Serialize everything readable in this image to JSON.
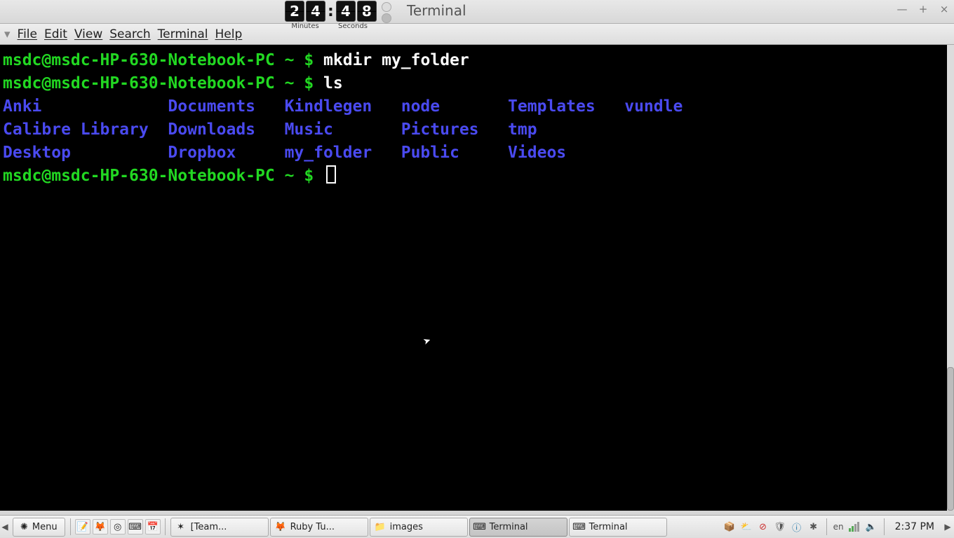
{
  "window": {
    "title": "Terminal",
    "timer": {
      "minutes": "24",
      "seconds": "48",
      "label_min": "Minutes",
      "label_sec": "Seconds"
    }
  },
  "menu": {
    "chevron": "▾",
    "items": [
      "File",
      "Edit",
      "View",
      "Search",
      "Terminal",
      "Help"
    ]
  },
  "prompt": {
    "userhost": "msdc@msdc-HP-630-Notebook-PC",
    "path": "~",
    "symbol": "$"
  },
  "session": {
    "cmd1": "mkdir my_folder",
    "cmd2": "ls",
    "ls": {
      "col1": [
        "Anki",
        "Calibre Library",
        "Desktop"
      ],
      "col2": [
        "Documents",
        "Downloads",
        "Dropbox"
      ],
      "col3": [
        "Kindlegen",
        "Music",
        "my_folder"
      ],
      "col4": [
        "node",
        "Pictures",
        "Public"
      ],
      "col5": [
        "Templates",
        "tmp",
        "Videos"
      ],
      "col6": [
        "vundle",
        "",
        ""
      ]
    }
  },
  "taskbar": {
    "menu_label": "Menu",
    "tasks": [
      {
        "label": "[Team...",
        "icon": "✶",
        "active": false
      },
      {
        "label": "Ruby Tu...",
        "icon": "🦊",
        "active": false
      },
      {
        "label": "images",
        "icon": "📁",
        "active": false
      },
      {
        "label": "Terminal",
        "icon": "⌨",
        "active": true
      },
      {
        "label": "Terminal",
        "icon": "⌨",
        "active": false
      }
    ],
    "lang": "en",
    "clock": "2:37 PM"
  }
}
